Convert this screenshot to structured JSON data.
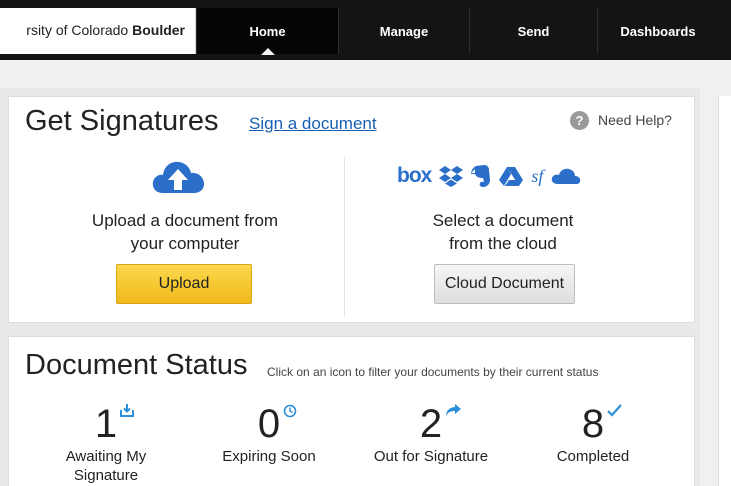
{
  "header": {
    "brand": {
      "prefix": "rsity of Colorado ",
      "bold": "Boulder"
    },
    "tabs": [
      {
        "label": "Home",
        "active": true
      },
      {
        "label": "Manage",
        "active": false
      },
      {
        "label": "Send",
        "active": false
      },
      {
        "label": "Dashboards",
        "active": false
      }
    ]
  },
  "get_signatures": {
    "title": "Get Signatures",
    "sign_link": "Sign a document",
    "help": "Need Help?",
    "upload": {
      "line1": "Upload a document from",
      "line2": "your computer",
      "button": "Upload"
    },
    "cloud": {
      "line1": "Select a document",
      "line2": "from the cloud",
      "button": "Cloud Document",
      "providers": {
        "box_text": "box",
        "sf_text": "sf",
        "icons": [
          "box-icon",
          "dropbox-icon",
          "evernote-icon",
          "google-drive-icon",
          "salesforce-icon",
          "onedrive-icon"
        ]
      }
    }
  },
  "document_status": {
    "title": "Document Status",
    "hint": "Click on an icon to filter your documents by their current status",
    "items": [
      {
        "count": "1",
        "label_line1": "Awaiting My",
        "label_line2": "Signature",
        "icon": "inbox-download-icon"
      },
      {
        "count": "0",
        "label_line1": "Expiring Soon",
        "label_line2": "",
        "icon": "clock-icon"
      },
      {
        "count": "2",
        "label_line1": "Out for Signature",
        "label_line2": "",
        "icon": "forward-arrow-icon"
      },
      {
        "count": "8",
        "label_line1": "Completed",
        "label_line2": "",
        "icon": "checkmark-icon"
      }
    ]
  },
  "colors": {
    "nav_background": "#141414",
    "link": "#1a5fb4",
    "accent_blue": "#2b6fcb",
    "upload_button": "#f6c72e"
  }
}
